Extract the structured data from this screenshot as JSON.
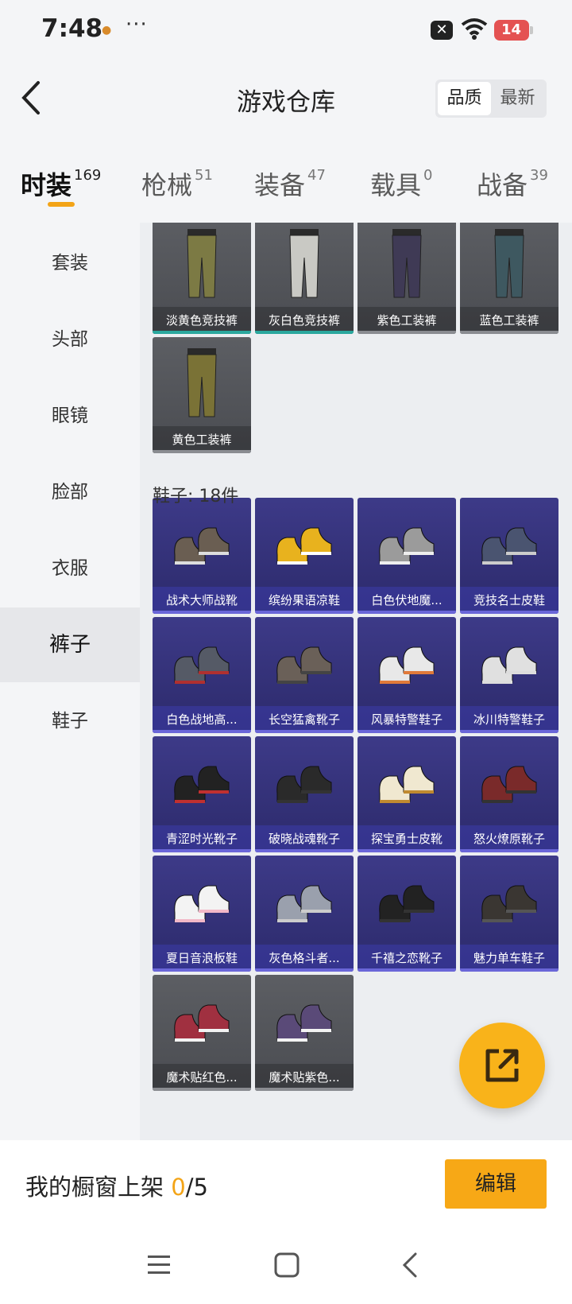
{
  "status_bar": {
    "time": "7:48",
    "dots": "···",
    "battery": "14"
  },
  "header": {
    "title": "游戏仓库",
    "sort_options": [
      "品质",
      "最新"
    ]
  },
  "tabs": [
    {
      "label": "时装",
      "count": "169"
    },
    {
      "label": "枪械",
      "count": "51"
    },
    {
      "label": "装备",
      "count": "47"
    },
    {
      "label": "载具",
      "count": "0"
    },
    {
      "label": "战备",
      "count": "39"
    }
  ],
  "sidebar": [
    "套装",
    "头部",
    "眼镜",
    "脸部",
    "衣服",
    "裤子",
    "鞋子"
  ],
  "pants_items": [
    "淡黄色竞技裤",
    "灰白色竞技裤",
    "紫色工装裤",
    "蓝色工装裤",
    "黄色工装裤"
  ],
  "shoes_section": {
    "label": "鞋子: 18件"
  },
  "shoes_items": [
    "战术大师战靴",
    "缤纷果语凉鞋",
    "白色伏地魔...",
    "竞技名士皮鞋",
    "白色战地高...",
    "长空猛禽靴子",
    "风暴特警鞋子",
    "冰川特警鞋子",
    "青涩时光靴子",
    "破晓战魂靴子",
    "探宝勇士皮靴",
    "怒火燎原靴子",
    "夏日音浪板鞋",
    "灰色格斗者...",
    "千禧之恋靴子",
    "魅力单车鞋子",
    "魔术贴红色...",
    "魔术贴紫色..."
  ],
  "bottom_bar": {
    "showcase_label": "我的橱窗上架",
    "count_current": "0",
    "count_total": "/5",
    "edit_label": "编辑"
  },
  "colors": {
    "accent": "#f3a417",
    "card_grey": "#55575c",
    "card_purple": "#35337a",
    "teal_bar": "#2aa89e"
  }
}
